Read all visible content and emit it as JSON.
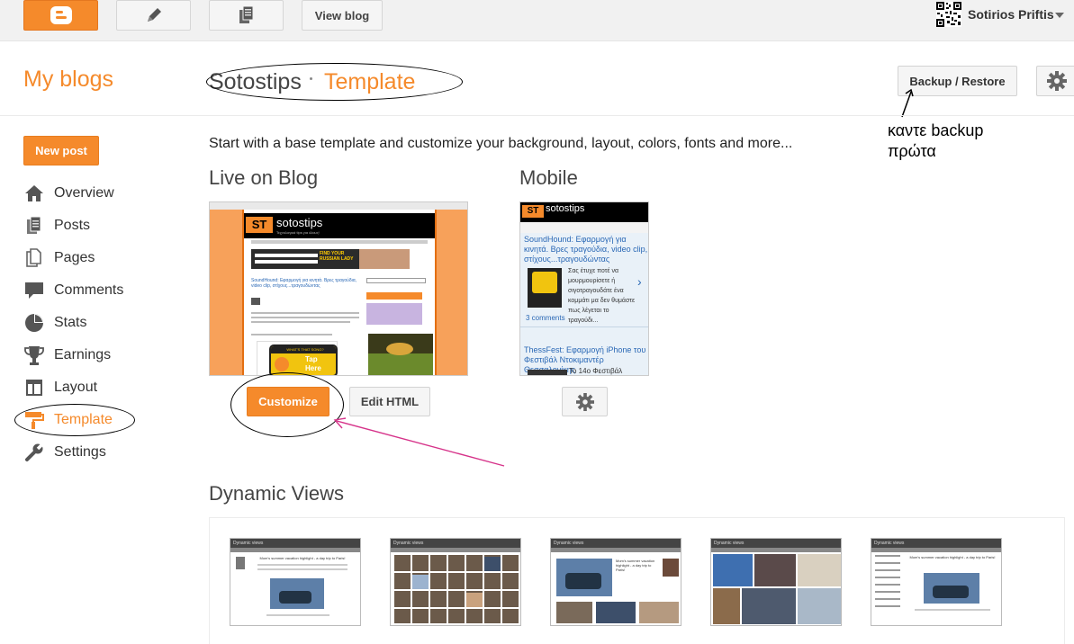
{
  "topbar": {
    "view_blog_label": "View blog",
    "username": "Sotirios Priftis",
    "icons": [
      "blogger-logo-icon",
      "pencil-icon",
      "copy-icon",
      "qr-code-icon",
      "chevron-down-icon"
    ]
  },
  "header": {
    "my_blogs": "My blogs",
    "blog_name": "Sotostips",
    "page_title": "Template",
    "backup_restore": "Backup / Restore",
    "annotation": [
      "καντε backup",
      "πρώτα"
    ]
  },
  "sidebar": {
    "new_post": "New post",
    "items": [
      {
        "label": "Overview",
        "icon": "home-icon"
      },
      {
        "label": "Posts",
        "icon": "posts-icon"
      },
      {
        "label": "Pages",
        "icon": "pages-icon"
      },
      {
        "label": "Comments",
        "icon": "comments-icon"
      },
      {
        "label": "Stats",
        "icon": "pie-chart-icon"
      },
      {
        "label": "Earnings",
        "icon": "trophy-icon"
      },
      {
        "label": "Layout",
        "icon": "layout-icon"
      },
      {
        "label": "Template",
        "icon": "paint-roller-icon",
        "active": true
      },
      {
        "label": "Settings",
        "icon": "wrench-icon"
      }
    ]
  },
  "main": {
    "intro": "Start with a base template and customize your background, layout, colors, fonts and more...",
    "live_title": "Live on Blog",
    "mobile_title": "Mobile",
    "customize_label": "Customize",
    "edit_html_label": "Edit HTML",
    "dynamic_views_title": "Dynamic Views",
    "live_preview": {
      "blog_title": "sotostips",
      "tagline": "Τεχνολογικά tips για όλους!",
      "ad_text": "FIND YOUR RUSSIAN LADY",
      "post_title": "SoundHound: Εφαρμογή για κινητά. Βρες τραγούδια, video clip, στίχους...τραγουδώντας",
      "app_badge_top": "WHAT'S THAT SONG?",
      "app_badge_text": "Tap Here"
    },
    "mobile_preview": {
      "blog_title": "sotostips",
      "post1_title": "SoundHound: Εφαρμογή για κινητά. Βρες τραγούδια, video clip, στίχους...τραγουδώντας",
      "post1_snippet": "Σας έτυχε ποτέ να μουρμουρίσετε ή σιγοτραγουδάτε ένα κομμάτι μα δεν θυμάστε πως λέγεται το τραγούδι...",
      "post1_comments": "3 comments",
      "post2_title": "ThessFest: Εφαρμογή iPhone του Φεστιβάλ Ντοκιμαντέρ Θεσσαλονίκης",
      "post2_snippet": "Το 14ο Φεστιβάλ"
    },
    "dynamic_views": [
      {
        "name": "Dynamic views",
        "headline": "Mom's summer vacation highlight - a day trip to Paris!",
        "style": "classic"
      },
      {
        "name": "Dynamic views",
        "headline": "",
        "style": "flipcard"
      },
      {
        "name": "Dynamic views",
        "headline": "Mom's summer vacation highlight - a day trip to Paris!",
        "style": "magazine"
      },
      {
        "name": "Dynamic views",
        "headline": "",
        "style": "mosaic"
      },
      {
        "name": "Dynamic views",
        "headline": "Mom's summer vacation highlight - a day trip to Paris!",
        "style": "sidebar"
      }
    ]
  },
  "colors": {
    "accent": "#f58a2b",
    "annotation_arrow": "#d6338a"
  }
}
